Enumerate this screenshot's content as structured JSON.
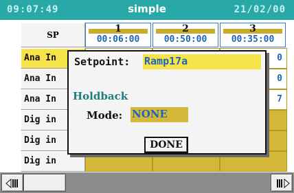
{
  "header": {
    "time": "09:07:49",
    "title": "simple",
    "date": "21/02/00"
  },
  "table": {
    "corner_label": "SP",
    "columns": [
      {
        "number": "1",
        "value": "00:06:00"
      },
      {
        "number": "2",
        "value": "00:50:00"
      },
      {
        "number": "3",
        "value": "00:35:00"
      }
    ],
    "rows": [
      {
        "label": "Ana In",
        "cells": [
          "",
          "",
          "0"
        ]
      },
      {
        "label": "Ana In",
        "cells": [
          "",
          "",
          "0"
        ]
      },
      {
        "label": "Ana In",
        "cells": [
          "",
          "",
          "7"
        ]
      },
      {
        "label": "Dig in",
        "cells": [
          "",
          "",
          ""
        ]
      },
      {
        "label": "Dig in",
        "cells": [
          "",
          "",
          ""
        ]
      },
      {
        "label": "Dig in",
        "cells": [
          "",
          "",
          ""
        ]
      }
    ]
  },
  "dialog": {
    "setpoint_label": "Setpoint:",
    "setpoint_value": "Ramp17a",
    "holdback_label": "Holdback",
    "mode_label": "Mode:",
    "mode_value": "NONE",
    "done_label": "DONE"
  },
  "footer": {
    "left_icon": "scroll-left-icon",
    "right_icon": "scroll-right-icon"
  },
  "colors": {
    "header": "#29a8a8",
    "highlight": "#f6e34a",
    "cell_fill": "#d4b83a",
    "value_text": "#1d64b8",
    "holdback_text": "#1d7d7d"
  }
}
